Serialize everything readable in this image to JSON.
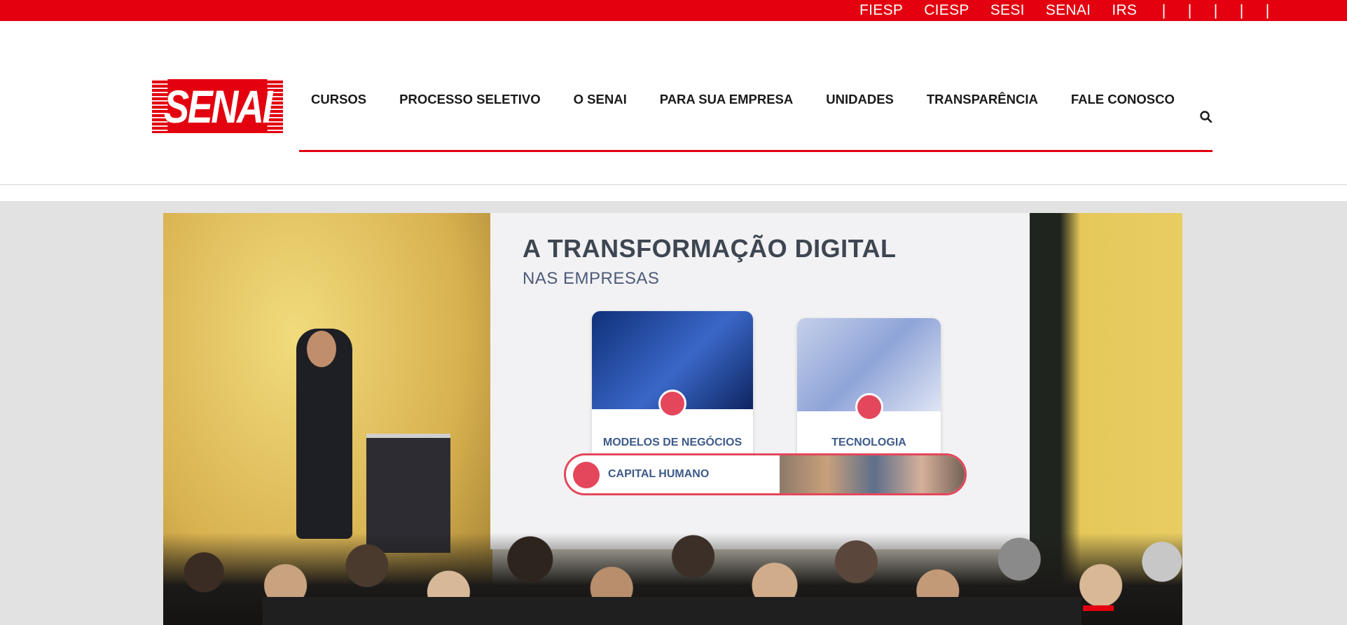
{
  "topbar": {
    "links": [
      "FIESP",
      "CIESP",
      "SESI",
      "SENAI",
      "IRS"
    ],
    "separators": [
      "|",
      "|",
      "|",
      "|",
      "|"
    ]
  },
  "header": {
    "logo_text": "SENAI",
    "nav": [
      "CURSOS",
      "PROCESSO SELETIVO",
      "O SENAI",
      "PARA SUA EMPRESA",
      "UNIDADES",
      "TRANSPARÊNCIA",
      "FALE CONOSCO"
    ]
  },
  "slide": {
    "title": "A TRANSFORMAÇÃO DIGITAL",
    "subtitle": "NAS EMPRESAS",
    "cards": [
      "MODELOS DE NEGÓCIOS",
      "TECNOLOGIA"
    ],
    "pill_label": "CAPITAL HUMANO"
  },
  "colors": {
    "brand_red": "#e3000f",
    "banner_bg": "#e2e2e2"
  },
  "icons": {
    "search": "search-icon"
  }
}
